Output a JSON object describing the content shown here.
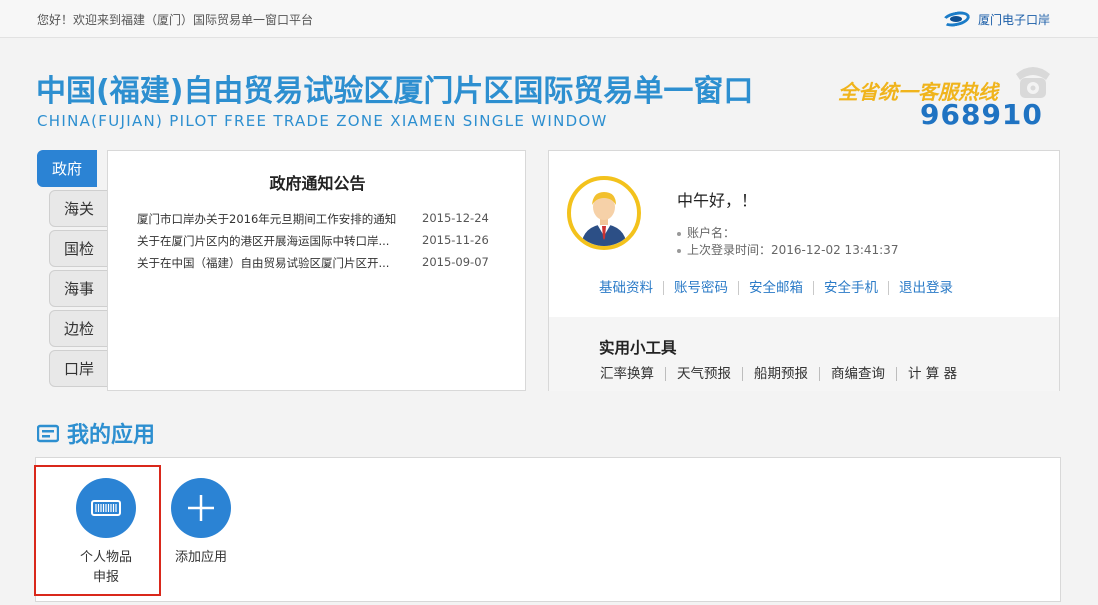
{
  "topbar": {
    "welcome": "您好！欢迎来到福建（厦门）国际贸易单一窗口平台",
    "portal_name": "厦门电子口岸"
  },
  "banner": {
    "title_cn": "中国(福建)自由贸易试验区厦门片区国际贸易单一窗口",
    "title_en": "CHINA(FUJIAN) PILOT FREE TRADE ZONE XIAMEN SINGLE WINDOW",
    "hotline_label": "全省统一客服热线",
    "hotline_number": "968910"
  },
  "tabs": [
    "政府",
    "海关",
    "国检",
    "海事",
    "边检",
    "口岸"
  ],
  "notice": {
    "title": "政府通知公告",
    "items": [
      {
        "text": "厦门市口岸办关于2016年元旦期间工作安排的通知",
        "date": "2015-12-24"
      },
      {
        "text": "关于在厦门片区内的港区开展海运国际中转口岸...",
        "date": "2015-11-26"
      },
      {
        "text": "关于在中国（福建）自由贸易试验区厦门片区开...",
        "date": "2015-09-07"
      }
    ]
  },
  "user": {
    "greeting": "中午好，！",
    "account_label": "账户名：",
    "last_login": "上次登录时间：2016-12-02 13:41:37",
    "links": [
      "基础资料",
      "账号密码",
      "安全邮箱",
      "安全手机",
      "退出登录"
    ]
  },
  "tools": {
    "title": "实用小工具",
    "links": [
      "汇率换算",
      "天气预报",
      "船期预报",
      "商编查询",
      "计 算 器"
    ]
  },
  "apps": {
    "heading": "我的应用",
    "items": [
      {
        "label_line1": "个人物品",
        "label_line2": "申报"
      },
      {
        "label_line1": "添加应用",
        "label_line2": ""
      }
    ]
  },
  "colors": {
    "accent": "#2b83d4",
    "title": "#2d8fd0",
    "hotline": "#f0b41c",
    "highlight": "#d9281b"
  }
}
